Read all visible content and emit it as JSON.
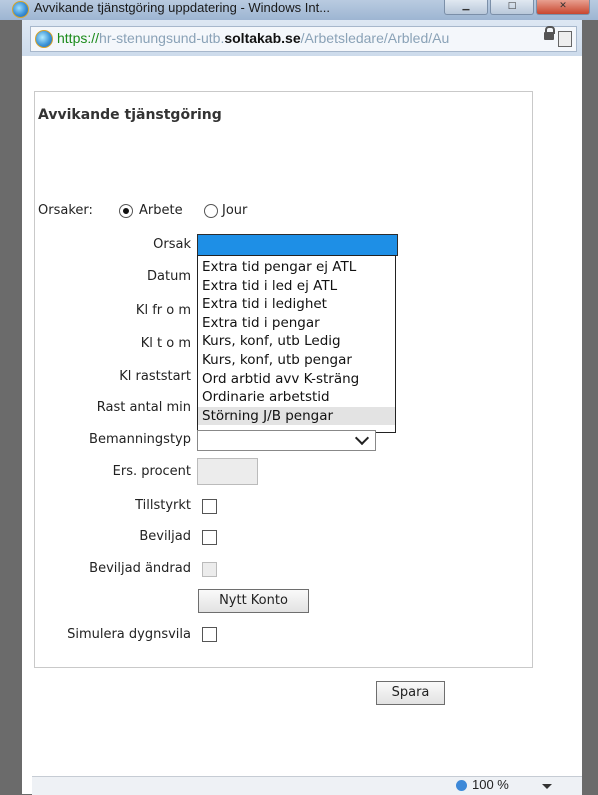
{
  "window": {
    "title": "Avvikande tjänstgöring uppdatering - Windows Int..."
  },
  "address_bar": {
    "scheme": "https://",
    "subdomain": "hr-stenungsund-utb.",
    "domain": "soltakab.se",
    "path": "/Arbetsledare/Arbled/Au"
  },
  "form": {
    "title": "Avvikande tjänstgöring",
    "orsaker_label": "Orsaker:",
    "radio_arbete": "Arbete",
    "radio_jour": "Jour",
    "selected_radio": "Arbete",
    "orsak_label": "Orsak",
    "datum_label": "Datum",
    "kl_from_label": "Kl fr o m",
    "kl_tom_label": "Kl t o m",
    "kl_raststart_label": "Kl raststart",
    "rast_antal_min_label": "Rast antal min",
    "bemanningstyp_label": "Bemanningstyp",
    "ers_procent_label": "Ers. procent",
    "tillstyrkt_label": "Tillstyrkt",
    "beviljad_label": "Beviljad",
    "beviljad_andrad_label": "Beviljad ändrad",
    "nytt_konto_button": "Nytt Konto",
    "simulera_label": "Simulera dygnsvila",
    "spara_button": "Spara"
  },
  "orsak_dropdown": {
    "options": [
      "Extra tid pengar ej ATL",
      "Extra tid i led ej ATL",
      "Extra tid i ledighet",
      "Extra tid i pengar",
      "Kurs, konf, utb Ledig",
      "Kurs, konf, utb pengar",
      "Ord arbtid avv K-sträng",
      "Ordinarie arbetstid",
      "Störning J/B pengar"
    ],
    "highlighted": "Störning J/B pengar"
  },
  "status_bar": {
    "zoom": "100 %"
  },
  "colors": {
    "select_highlight": "#1e8fe6",
    "titlebar": "#b9cbe0"
  }
}
